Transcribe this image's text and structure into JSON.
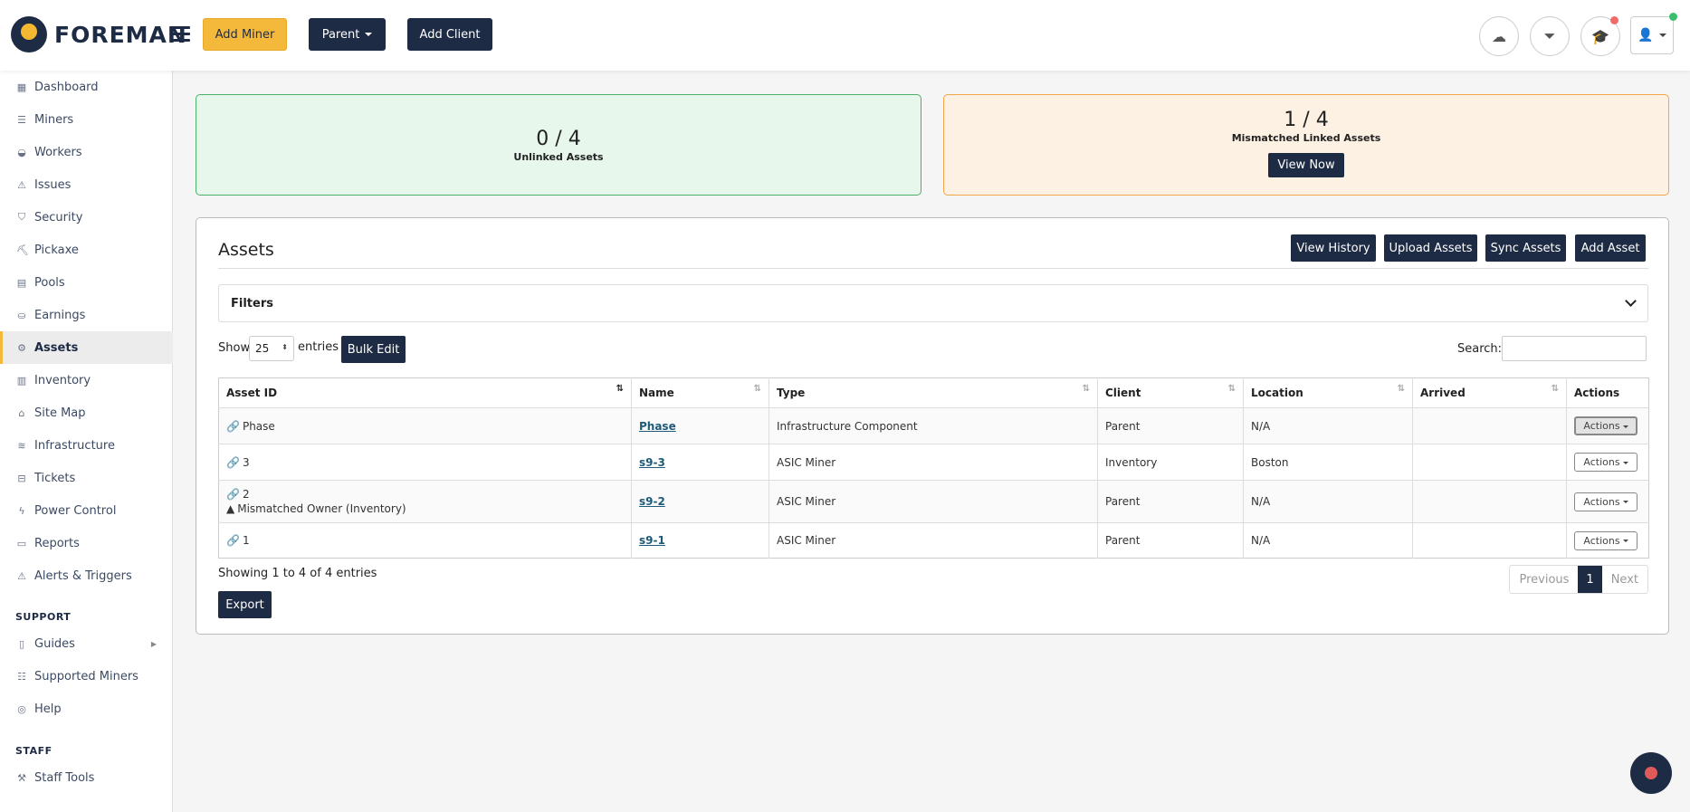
{
  "header": {
    "brand": "FOREMAN",
    "add_miner": "Add Miner",
    "parent": "Parent",
    "add_client": "Add Client"
  },
  "sidebar": {
    "items": [
      {
        "label": "Dashboard",
        "icon": "dashboard-icon"
      },
      {
        "label": "Miners",
        "icon": "server-icon"
      },
      {
        "label": "Workers",
        "icon": "helmet-icon"
      },
      {
        "label": "Issues",
        "icon": "warning-icon"
      },
      {
        "label": "Security",
        "icon": "shield-icon"
      },
      {
        "label": "Pickaxe",
        "icon": "pickaxe-icon"
      },
      {
        "label": "Pools",
        "icon": "pools-icon"
      },
      {
        "label": "Earnings",
        "icon": "earnings-icon"
      },
      {
        "label": "Assets",
        "icon": "gear-icon"
      },
      {
        "label": "Inventory",
        "icon": "inventory-icon"
      },
      {
        "label": "Site Map",
        "icon": "sitemap-icon"
      },
      {
        "label": "Infrastructure",
        "icon": "layers-icon"
      },
      {
        "label": "Tickets",
        "icon": "ticket-icon"
      },
      {
        "label": "Power Control",
        "icon": "bolt-icon"
      },
      {
        "label": "Reports",
        "icon": "report-icon"
      },
      {
        "label": "Alerts & Triggers",
        "icon": "alert-icon"
      }
    ],
    "support_title": "SUPPORT",
    "support_items": [
      {
        "label": "Guides",
        "icon": "book-icon"
      },
      {
        "label": "Supported Miners",
        "icon": "list-icon"
      },
      {
        "label": "Help",
        "icon": "help-icon"
      }
    ],
    "staff_title": "STAFF",
    "staff_items": [
      {
        "label": "Staff Tools",
        "icon": "tools-icon"
      }
    ],
    "active": "Assets"
  },
  "summary": {
    "unlinked_value": "0 / 4",
    "unlinked_label": "Unlinked Assets",
    "mismatched_value": "1 / 4",
    "mismatched_label": "Mismatched Linked Assets",
    "view_now": "View Now"
  },
  "assets": {
    "title": "Assets",
    "view_history": "View History",
    "upload_assets": "Upload Assets",
    "sync_assets": "Sync Assets",
    "add_asset": "Add Asset",
    "filters": "Filters",
    "show": "Show",
    "entries_value": "25",
    "entries": "entries",
    "bulk_edit": "Bulk Edit",
    "search_label": "Search:",
    "search_value": "",
    "columns": [
      "Asset ID",
      "Name",
      "Type",
      "Client",
      "Location",
      "Arrived",
      "Actions"
    ],
    "rows": [
      {
        "asset_id": "Phase",
        "warning": "",
        "name": "Phase",
        "type": "Infrastructure Component",
        "client": "Parent",
        "location": "N/A",
        "arrived": "",
        "action": "Actions"
      },
      {
        "asset_id": "3",
        "warning": "",
        "name": "s9-3",
        "type": "ASIC Miner",
        "client": "Inventory",
        "location": "Boston",
        "arrived": "",
        "action": "Actions"
      },
      {
        "asset_id": "2",
        "warning": "Mismatched Owner (Inventory)",
        "name": "s9-2",
        "type": "ASIC Miner",
        "client": "Parent",
        "location": "N/A",
        "arrived": "",
        "action": "Actions"
      },
      {
        "asset_id": "1",
        "warning": "",
        "name": "s9-1",
        "type": "ASIC Miner",
        "client": "Parent",
        "location": "N/A",
        "arrived": "",
        "action": "Actions"
      }
    ],
    "showing": "Showing 1 to 4 of 4 entries",
    "export": "Export",
    "previous": "Previous",
    "page": "1",
    "next": "Next"
  },
  "colors": {
    "brand": "#1e2b45",
    "accent": "#f4b93a",
    "success_bg": "#e7f7ec",
    "warning_bg": "#fdf1e3"
  }
}
